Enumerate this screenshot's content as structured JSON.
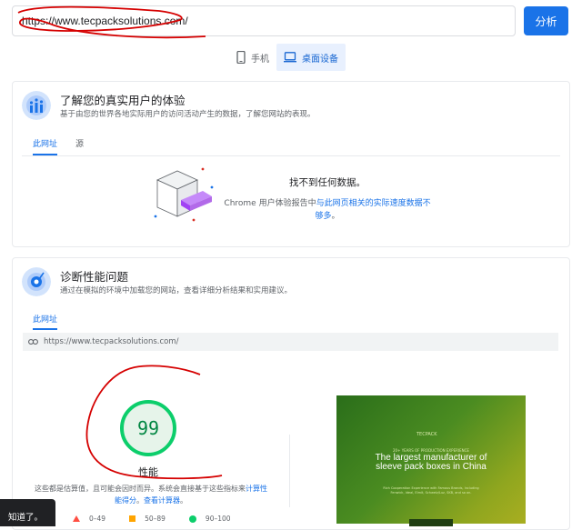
{
  "top": {
    "url_value": "https://www.tecpacksolutions.com/",
    "analyze_label": "分析"
  },
  "device_tabs": [
    {
      "label": "手机",
      "icon": "phone-icon",
      "active": false
    },
    {
      "label": "桌面设备",
      "icon": "desktop-icon",
      "active": true
    }
  ],
  "field_card": {
    "title": "了解您的真实用户的体验",
    "subtitle": "基于由您的世界各地实际用户的访问活动产生的数据，了解您网站的表现。",
    "tabs": [
      "此网址",
      "源"
    ],
    "nodata_title": "找不到任何数据。",
    "nodata_prefix": "Chrome 用户体验报告中",
    "nodata_link": "与此网页相关的实际速度数据不够多",
    "nodata_suffix": "。"
  },
  "lab_card": {
    "title": "诊断性能问题",
    "subtitle": "通过在模拟的环境中加载您的网站，查看详细分析结果和实用建议。",
    "tab": "此网址",
    "url": "https://www.tecpacksolutions.com/",
    "score": "99",
    "score_label": "性能",
    "est_prefix": "这些都是估算值，且可能会因时而异。系统会直接基于这些指标来",
    "est_link1": "计算性能得分",
    "est_mid": "。",
    "est_link2": "查看计算器",
    "est_suffix": "。",
    "legend": [
      {
        "label": "0–49",
        "color": "#ff4e42",
        "shape": "triangle"
      },
      {
        "label": "50–89",
        "color": "#ffa400",
        "shape": "square"
      },
      {
        "label": "90–100",
        "color": "#0cce6b",
        "shape": "circle"
      }
    ]
  },
  "preview": {
    "brand": "TECPACK",
    "kicker": "20+ YEARS OF PRODUCTION EXPERIENCE",
    "headline": "The largest manufacturer of sleeve pack boxes in China",
    "small": "Rich Cooperation Experience with Famous Brands, Including Fenwick, Ideal, Elmit, Schweiz/Luz, SKB, and so on."
  },
  "toast": {
    "label": "知道了。"
  },
  "colors": {
    "accent": "#1a73e8",
    "good": "#0cce6b",
    "annotation": "#d50000"
  }
}
